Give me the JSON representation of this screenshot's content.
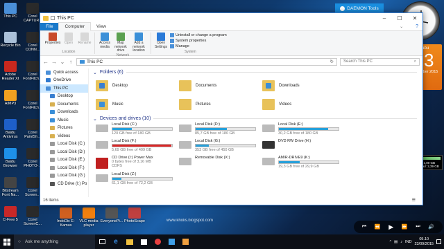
{
  "desktop_icons": [
    {
      "label": "This PC",
      "color": "#4a8fd8"
    },
    {
      "label": "Recycle Bin",
      "color": "#aac0d8"
    },
    {
      "label": "Adobe Reader XI",
      "color": "#c8281e"
    },
    {
      "label": "AIMP3",
      "color": "#f0a020"
    },
    {
      "label": "Baidu Antivirus",
      "color": "#1e5fc8"
    },
    {
      "label": "Baidu Browser",
      "color": "#1e90e8"
    },
    {
      "label": "Bitstream Font Na...",
      "color": "#444444"
    },
    {
      "label": "C-Free 5",
      "color": "#c82828"
    }
  ],
  "desktop_icons_col2": [
    {
      "label": "Corel CAPTURE",
      "color": "#2a2a2a"
    },
    {
      "label": "Corel CONN...",
      "color": "#2a2a2a"
    },
    {
      "label": "Corel FontFitch...",
      "color": "#2a2a2a"
    },
    {
      "label": "Corel FontFitch...",
      "color": "#2a2a2a"
    },
    {
      "label": "Corel PaintSh...",
      "color": "#2a2a2a"
    },
    {
      "label": "Corel PHOTO-...",
      "color": "#2a2a2a"
    },
    {
      "label": "Corel Screen...",
      "color": "#2a2a2a"
    },
    {
      "label": "Corel ScreenC...",
      "color": "#2a2a2a"
    }
  ],
  "bottom_icons": [
    {
      "label": "IndoDic E-Kamus",
      "color": "#d06020"
    },
    {
      "label": "VLC media player",
      "color": "#f08010"
    },
    {
      "label": "EveryonePi...",
      "color": "#555555"
    },
    {
      "label": "PhotoScape",
      "color": "#c04040"
    }
  ],
  "daemon": {
    "label": "DAEMON Tools"
  },
  "calendar": {
    "day": "Rabu",
    "date": "23",
    "month": "September 2015"
  },
  "watermark": "www.kholis.blogspot.com",
  "window": {
    "title": "This PC",
    "tabs": [
      "File",
      "Computer",
      "View"
    ],
    "ribbon": {
      "location": {
        "name": "Location",
        "items": [
          "Properties",
          "Open",
          "Rename"
        ]
      },
      "network": {
        "name": "Network",
        "items": [
          "Access media",
          "Map network drive",
          "Add a network location"
        ]
      },
      "system": {
        "name": "System",
        "open_settings": "Open Settings",
        "items": [
          "Uninstall or change a program",
          "System properties",
          "Manage"
        ]
      }
    },
    "address": "This PC",
    "search_placeholder": "Search This PC",
    "nav": [
      {
        "label": "Quick access",
        "color": "#4a90d9",
        "sub": false
      },
      {
        "label": "OneDrive",
        "color": "#2f7ad0",
        "sub": false
      },
      {
        "label": "This PC",
        "color": "#4a8fd8",
        "sub": false,
        "selected": true
      },
      {
        "label": "Desktop",
        "color": "#3a7fd0",
        "sub": true
      },
      {
        "label": "Documents",
        "color": "#d8b050",
        "sub": true
      },
      {
        "label": "Downloads",
        "color": "#3a8fd8",
        "sub": true
      },
      {
        "label": "Music",
        "color": "#3a8fd8",
        "sub": true
      },
      {
        "label": "Pictures",
        "color": "#d8b050",
        "sub": true
      },
      {
        "label": "Videos",
        "color": "#d8b050",
        "sub": true
      },
      {
        "label": "Local Disk (C:)",
        "color": "#999999",
        "sub": true
      },
      {
        "label": "Local Disk (D:)",
        "color": "#999999",
        "sub": true
      },
      {
        "label": "Local Disk (E:)",
        "color": "#999999",
        "sub": true
      },
      {
        "label": "Local Disk (F:)",
        "color": "#999999",
        "sub": true
      },
      {
        "label": "Local Disk (G:)",
        "color": "#999999",
        "sub": true
      },
      {
        "label": "CD Drive (I:) Po",
        "color": "#555555",
        "sub": true
      }
    ],
    "folders_header": "Folders (6)",
    "folders": [
      "Desktop",
      "Documents",
      "Downloads",
      "Music",
      "Pictures",
      "Videos"
    ],
    "drives_header": "Devices and drives (10)",
    "drives": [
      {
        "name": "Local Disk (C:)",
        "free": "120 GB free of 180 GB",
        "fill": 0.33,
        "red": false
      },
      {
        "name": "Local Disk (D:)",
        "free": "85,7 GB free of 180 GB",
        "fill": 0.52,
        "red": false
      },
      {
        "name": "Local Disk (E:)",
        "free": "30,2 GB free of 180 GB",
        "fill": 0.83,
        "red": false
      },
      {
        "name": "Local Disk (F:)",
        "free": "5,69 GB free of 409 GB",
        "fill": 0.99,
        "red": true
      },
      {
        "name": "Local Disk (G:)",
        "free": "353 GB free of 450 GB",
        "fill": 0.22,
        "red": false
      },
      {
        "name": "DVD RW Drive (H:)",
        "free": "",
        "fill": null,
        "red": false
      },
      {
        "name": "CD Drive (I:) Power Max",
        "free": "0 bytes free of 3,16 MB",
        "extra": "CDFS",
        "fill": null,
        "red": false
      },
      {
        "name": "Removable Disk (X:)",
        "free": "",
        "fill": null,
        "red": false
      },
      {
        "name": "AMIR-DRIVE9 (K:)",
        "free": "19,3 GB free of 29,9 GB",
        "fill": 0.35,
        "red": false
      },
      {
        "name": "Local Disk (Z:)",
        "free": "61,1 GB free of 72,2 GB",
        "fill": 0.15,
        "red": false
      }
    ],
    "status": "16 items"
  },
  "taskbar": {
    "search": "Ask me anything",
    "lang": "IND",
    "time": "05.10",
    "date": "23/09/2015"
  },
  "gadget": {
    "upload": "Total Upload: 1,00 GB",
    "download": "Total Download: 2,39 GB"
  }
}
